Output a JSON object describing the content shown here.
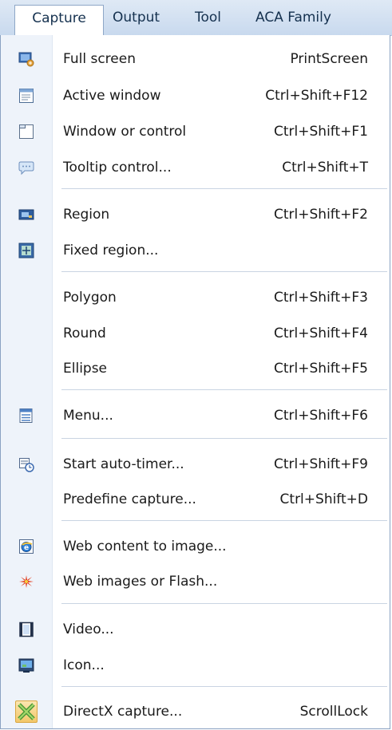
{
  "menubar": {
    "items": [
      {
        "label": "Capture",
        "active": true
      },
      {
        "label": "Output",
        "active": false
      },
      {
        "label": "Tool",
        "active": false
      },
      {
        "label": "ACA Family",
        "active": false
      }
    ]
  },
  "menu": {
    "items": [
      {
        "label": "Full screen",
        "shortcut": "PrintScreen",
        "icon": "full-screen-icon"
      },
      {
        "label": "Active window",
        "shortcut": "Ctrl+Shift+F12",
        "icon": "active-window-icon"
      },
      {
        "label": "Window or control",
        "shortcut": "Ctrl+Shift+F1",
        "icon": "window-control-icon"
      },
      {
        "label": "Tooltip control...",
        "shortcut": "Ctrl+Shift+T",
        "icon": "tooltip-icon"
      },
      {
        "label": "Region",
        "shortcut": "Ctrl+Shift+F2",
        "icon": "region-icon"
      },
      {
        "label": "Fixed region...",
        "shortcut": "",
        "icon": "fixed-region-icon"
      },
      {
        "label": "Polygon",
        "shortcut": "Ctrl+Shift+F3",
        "icon": ""
      },
      {
        "label": "Round",
        "shortcut": "Ctrl+Shift+F4",
        "icon": ""
      },
      {
        "label": "Ellipse",
        "shortcut": "Ctrl+Shift+F5",
        "icon": ""
      },
      {
        "label": "Menu...",
        "shortcut": "Ctrl+Shift+F6",
        "icon": "menu-icon"
      },
      {
        "label": "Start auto-timer...",
        "shortcut": "Ctrl+Shift+F9",
        "icon": "timer-icon"
      },
      {
        "label": "Predefine capture...",
        "shortcut": "Ctrl+Shift+D",
        "icon": ""
      },
      {
        "label": "Web content to image...",
        "shortcut": "",
        "icon": "web-content-icon"
      },
      {
        "label": "Web images or Flash...",
        "shortcut": "",
        "icon": "web-images-icon"
      },
      {
        "label": "Video...",
        "shortcut": "",
        "icon": "video-icon"
      },
      {
        "label": "Icon...",
        "shortcut": "",
        "icon": "icon-capture-icon"
      },
      {
        "label": "DirectX capture...",
        "shortcut": "ScrollLock",
        "icon": "directx-icon"
      }
    ]
  },
  "colors": {
    "menubar_bg": "#c8d9ee",
    "gutter_bg": "#eef3fa",
    "separator": "#c9d4e2",
    "text": "#1a1a1a"
  }
}
